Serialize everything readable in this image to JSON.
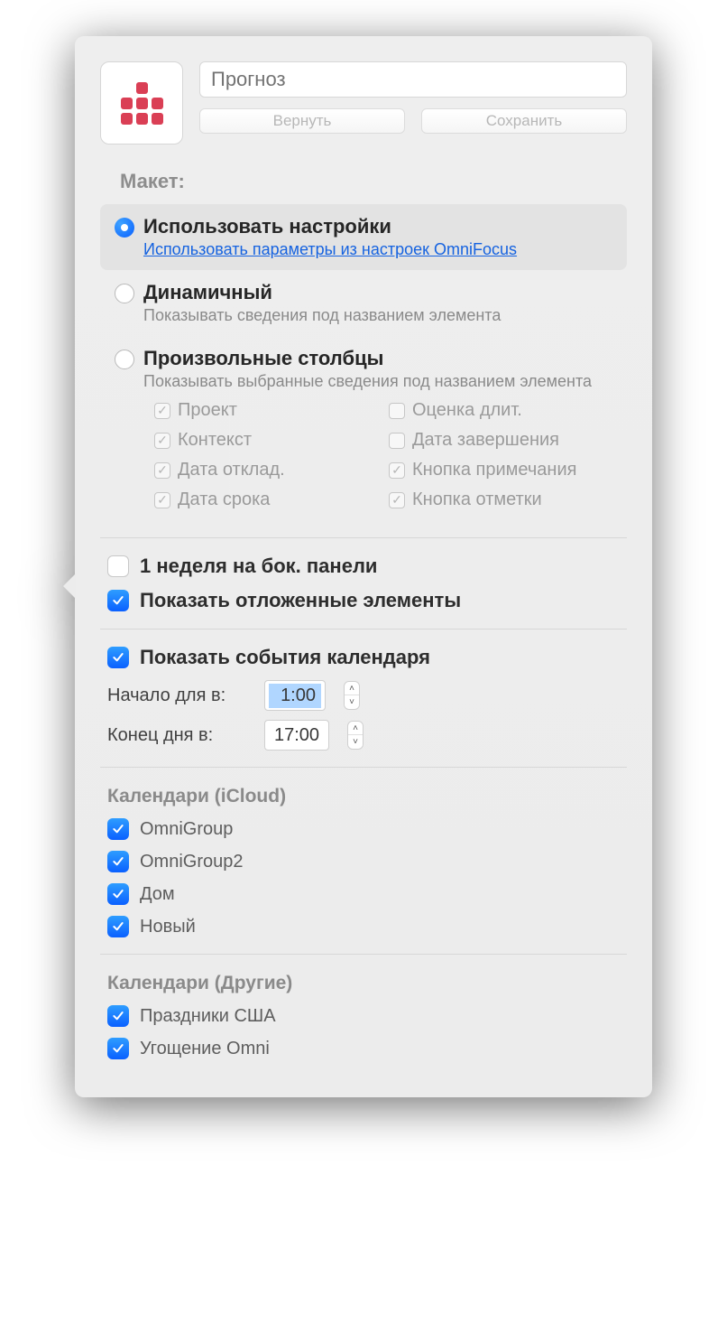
{
  "header": {
    "name": "Прогноз",
    "revert": "Вернуть",
    "save": "Сохранить"
  },
  "layout_label": "Макет:",
  "layout": {
    "use": {
      "title": "Использовать настройки",
      "sub": "Использовать параметры из настроек OmniFocus"
    },
    "fluid": {
      "title": "Динамичный",
      "sub": "Показывать сведения под названием элемента"
    },
    "custom": {
      "title": "Произвольные столбцы",
      "sub": "Показывать выбранные сведения под названием элемента"
    }
  },
  "cols": {
    "project": "Проект",
    "context": "Контекст",
    "defer": "Дата отклад.",
    "due": "Дата срока",
    "estimate": "Оценка длит.",
    "complete": "Дата завершения",
    "note": "Кнопка примечания",
    "flag": "Кнопка отметки"
  },
  "opts": {
    "week_sidebar": "1 неделя на бок. панели",
    "show_deferred": "Показать отложенные элементы",
    "show_cal": "Показать события календаря"
  },
  "times": {
    "start_label": "Начало для в:",
    "start_val": "1:00",
    "end_label": "Конец дня в:",
    "end_val": "17:00"
  },
  "cal_icloud": {
    "title": "Календари (iCloud)",
    "c1": "OmniGroup",
    "c2": "OmniGroup2",
    "c3": "Дом",
    "c4": "Новый"
  },
  "cal_other": {
    "title": "Календари (Другие)",
    "c1": "Праздники США",
    "c2": "Угощение Omni"
  }
}
